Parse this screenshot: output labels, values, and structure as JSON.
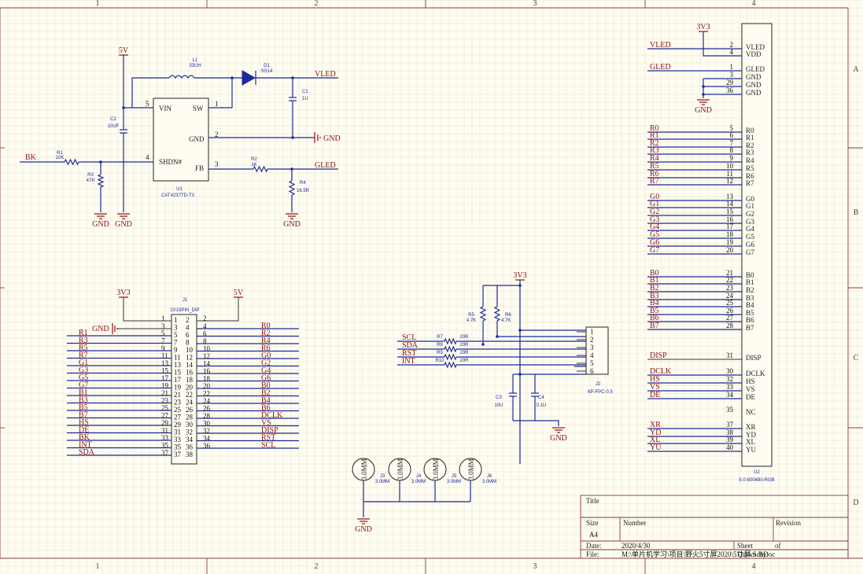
{
  "frame": {
    "columns": [
      "1",
      "2",
      "3",
      "4"
    ],
    "rows": [
      "A",
      "B",
      "C",
      "D"
    ]
  },
  "regulator": {
    "chip": {
      "pins": [
        "VIN",
        "SW",
        "GND",
        "SHDN#",
        "FB"
      ],
      "designator": "U1",
      "part": "CAT4237TD-T3",
      "pin_numbers": [
        "5",
        "1",
        "2",
        "4",
        "3"
      ]
    },
    "l1": {
      "des": "L1",
      "val": "33UH"
    },
    "d1": {
      "des": "D1",
      "val": "SS14"
    },
    "c1": {
      "des": "C1",
      "val": "1U"
    },
    "c2": {
      "des": "C2",
      "val": "10UF"
    },
    "r1": {
      "des": "R1",
      "val": "10K"
    },
    "r2": {
      "des": "R2",
      "val": "1K"
    },
    "r3": {
      "des": "R3",
      "val": "47K"
    },
    "r4": {
      "des": "R4",
      "val": "16.5R"
    },
    "power_5v": "5V",
    "nets": {
      "bk": "BK",
      "vled": "VLED",
      "gled": "GLED",
      "gnd_in": "GND"
    },
    "grounds": [
      "GND",
      "GND",
      "GND"
    ]
  },
  "header": {
    "designator": "J1",
    "part": "2X19PIN_DIP",
    "power_3v3": "3V3",
    "power_5v": "5V",
    "gnd": "GND",
    "left_nets": [
      "R1",
      "R3",
      "R5",
      "R7",
      "G1",
      "G3",
      "G5",
      "G7",
      "B1",
      "B3",
      "B5",
      "B7",
      "HS",
      "DE",
      "BK",
      "INT",
      "SDA"
    ],
    "right_nets": [
      "R0",
      "R2",
      "R4",
      "R6",
      "G0",
      "G2",
      "G4",
      "G6",
      "B0",
      "B2",
      "B4",
      "B6",
      "DCLK",
      "VS",
      "DISP",
      "RST",
      "SCL"
    ],
    "inner_pins": [
      [
        "1",
        "2"
      ],
      [
        "3",
        "4"
      ],
      [
        "5",
        "6"
      ],
      [
        "7",
        "8"
      ],
      [
        "9",
        "10"
      ],
      [
        "11",
        "12"
      ],
      [
        "13",
        "14"
      ],
      [
        "15",
        "16"
      ],
      [
        "17",
        "18"
      ],
      [
        "19",
        "20"
      ],
      [
        "21",
        "22"
      ],
      [
        "23",
        "24"
      ],
      [
        "25",
        "26"
      ],
      [
        "27",
        "28"
      ],
      [
        "29",
        "30"
      ],
      [
        "31",
        "32"
      ],
      [
        "33",
        "34"
      ],
      [
        "35",
        "36"
      ],
      [
        "37",
        "38"
      ]
    ],
    "left_pin_numbers": [
      "3",
      "5",
      "7",
      "9",
      "11",
      "13",
      "15",
      "17",
      "19",
      "21",
      "23",
      "25",
      "27",
      "29",
      "31",
      "33",
      "35",
      "37"
    ],
    "right_pin_numbers": [
      "2",
      "4",
      "6",
      "8",
      "10",
      "12",
      "14",
      "16",
      "18",
      "20",
      "22",
      "24",
      "26",
      "28",
      "30",
      "32",
      "34",
      "36",
      "38"
    ]
  },
  "touch": {
    "power_3v3": "3V3",
    "nets": [
      "SCL",
      "SDA",
      "RST",
      "INT"
    ],
    "series_res": [
      {
        "des": "R7",
        "val": "20R"
      },
      {
        "des": "R8",
        "val": "20R"
      },
      {
        "des": "R9",
        "val": "20R"
      },
      {
        "des": "R10",
        "val": "20R"
      }
    ],
    "r5": {
      "des": "R5",
      "val": "4.7K"
    },
    "r6": {
      "des": "R6",
      "val": "4.7K"
    },
    "c3": {
      "des": "C3",
      "val": "10U"
    },
    "c4": {
      "des": "C4",
      "val": "0.1U"
    },
    "connector": {
      "des": "J2",
      "part": "6P-FPC-0.5",
      "pins": [
        "1",
        "2",
        "3",
        "4",
        "5",
        "6"
      ]
    },
    "gnd": "GND"
  },
  "holes": {
    "items": [
      {
        "label": "3.0MM",
        "des": "J3",
        "val": "3.0MM"
      },
      {
        "label": "3.0MM",
        "des": "J4",
        "val": "3.0MM"
      },
      {
        "label": "3.0MM",
        "des": "J5",
        "val": "3.0MM"
      },
      {
        "label": "3.0MM",
        "des": "J6",
        "val": "3.0MM"
      }
    ],
    "gnd": "GND"
  },
  "lcd": {
    "designator": "U2",
    "part": "5.0-800480-RGB",
    "power_3v3": "3V3",
    "gnd": "GND",
    "pins": [
      {
        "num": "2",
        "name": "VLED",
        "net": "VLED"
      },
      {
        "num": "4",
        "name": "VDD",
        "net": ""
      },
      {
        "num": "1",
        "name": "GLED",
        "net": "GLED"
      },
      {
        "num": "3",
        "name": "GND",
        "net": ""
      },
      {
        "num": "29",
        "name": "GND",
        "net": ""
      },
      {
        "num": "36",
        "name": "GND",
        "net": ""
      },
      {
        "num": "5",
        "name": "R0",
        "net": "R0"
      },
      {
        "num": "6",
        "name": "R1",
        "net": "R1"
      },
      {
        "num": "7",
        "name": "R2",
        "net": "R2"
      },
      {
        "num": "8",
        "name": "R3",
        "net": "R3"
      },
      {
        "num": "9",
        "name": "R4",
        "net": "R4"
      },
      {
        "num": "10",
        "name": "R5",
        "net": "R5"
      },
      {
        "num": "11",
        "name": "R6",
        "net": "R6"
      },
      {
        "num": "12",
        "name": "R7",
        "net": "R7"
      },
      {
        "num": "13",
        "name": "G0",
        "net": "G0"
      },
      {
        "num": "14",
        "name": "G1",
        "net": "G1"
      },
      {
        "num": "15",
        "name": "G2",
        "net": "G2"
      },
      {
        "num": "16",
        "name": "G3",
        "net": "G3"
      },
      {
        "num": "17",
        "name": "G4",
        "net": "G4"
      },
      {
        "num": "18",
        "name": "G5",
        "net": "G5"
      },
      {
        "num": "19",
        "name": "G6",
        "net": "G6"
      },
      {
        "num": "20",
        "name": "G7",
        "net": "G7"
      },
      {
        "num": "21",
        "name": "B0",
        "net": "B0"
      },
      {
        "num": "22",
        "name": "B1",
        "net": "B1"
      },
      {
        "num": "23",
        "name": "B2",
        "net": "B2"
      },
      {
        "num": "24",
        "name": "B3",
        "net": "B3"
      },
      {
        "num": "25",
        "name": "B4",
        "net": "B4"
      },
      {
        "num": "26",
        "name": "B5",
        "net": "B5"
      },
      {
        "num": "27",
        "name": "B6",
        "net": "B6"
      },
      {
        "num": "28",
        "name": "B7",
        "net": "B7"
      },
      {
        "num": "31",
        "name": "DISP",
        "net": "DISP"
      },
      {
        "num": "30",
        "name": "DCLK",
        "net": "DCLK"
      },
      {
        "num": "32",
        "name": "HS",
        "net": "HS"
      },
      {
        "num": "33",
        "name": "VS",
        "net": "VS"
      },
      {
        "num": "34",
        "name": "DE",
        "net": "DE"
      },
      {
        "num": "35",
        "name": "NC",
        "net": ""
      },
      {
        "num": "37",
        "name": "XR",
        "net": "XR"
      },
      {
        "num": "38",
        "name": "YD",
        "net": "YD"
      },
      {
        "num": "39",
        "name": "XL",
        "net": "XL"
      },
      {
        "num": "40",
        "name": "YU",
        "net": "YU"
      }
    ]
  },
  "title_block": {
    "title_label": "Title",
    "size_label": "Size",
    "size_value": "A4",
    "number_label": "Number",
    "revision_label": "Revision",
    "date_label": "Date:",
    "date_value": "2020/4/30",
    "sheet_label": "Sheet",
    "of_label": "of",
    "file_label": "File:",
    "file_value": "M:\\单片机学习\\项目\\野火5寸屏2020\\5寸屏.SchDoc",
    "drawn_label": "Drawn By:"
  }
}
